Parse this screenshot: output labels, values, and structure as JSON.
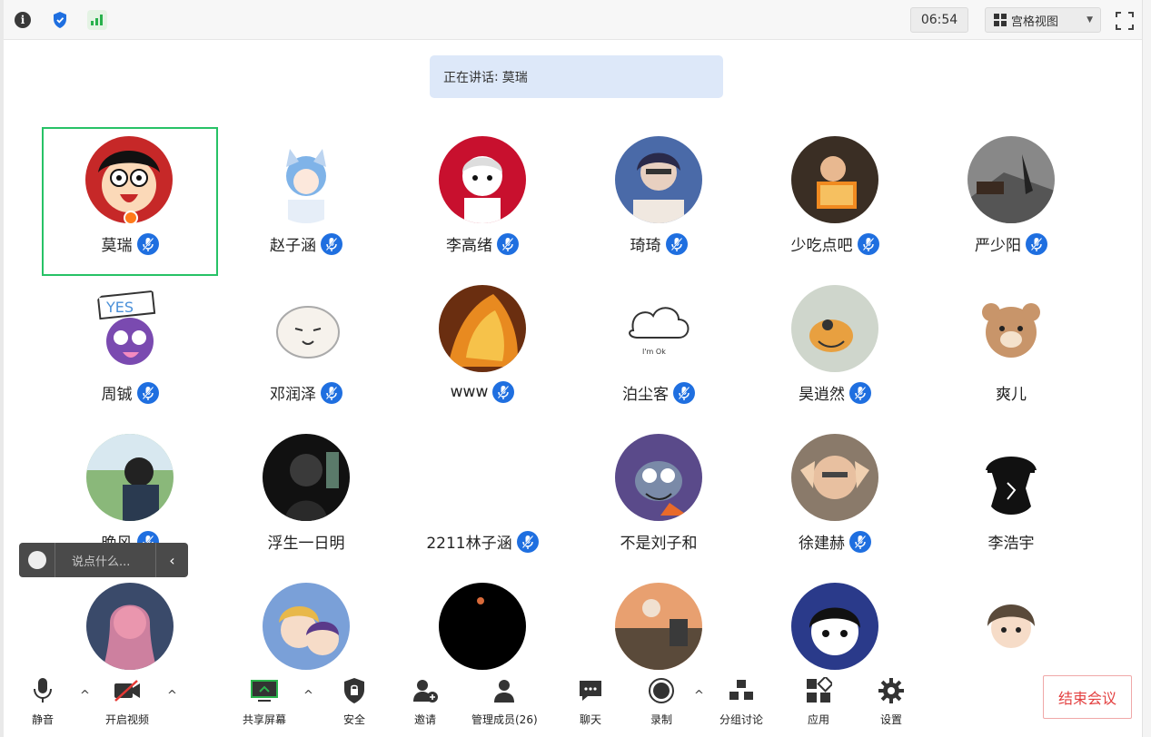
{
  "top_bar": {
    "info_icon": "info-icon",
    "shield_icon": "shield-icon",
    "signal_icon": "signal-bars-icon",
    "timer": "06:54",
    "view_mode": "宫格视图",
    "fullscreen_icon": "fullscreen-icon"
  },
  "speaking": {
    "prefix": "正在讲话",
    "separator": ":",
    "name": "莫瑞"
  },
  "participants": [
    {
      "name": "莫瑞",
      "mic": true,
      "host": true,
      "active": true
    },
    {
      "name": "赵子涵",
      "mic": true
    },
    {
      "name": "李高绪",
      "mic": true
    },
    {
      "name": "琦琦",
      "mic": true
    },
    {
      "name": "少吃点吧",
      "mic": true
    },
    {
      "name": "严少阳",
      "mic": true
    },
    {
      "name": "周铖",
      "mic": true
    },
    {
      "name": "邓润泽",
      "mic": true
    },
    {
      "name": "www",
      "mic": true
    },
    {
      "name": "泊尘客",
      "mic": true
    },
    {
      "name": "昊逍然",
      "mic": true
    },
    {
      "name": "爽儿",
      "mic": false
    },
    {
      "name": "晚风",
      "mic": true
    },
    {
      "name": "浮生一日明",
      "mic": false
    },
    {
      "name": "2211林子涵",
      "mic": true
    },
    {
      "name": "不是刘子和",
      "mic": false
    },
    {
      "name": "徐建赫",
      "mic": true
    },
    {
      "name": "李浩宇",
      "mic": false
    },
    {
      "name": "",
      "mic": false
    },
    {
      "name": "",
      "mic": false
    },
    {
      "name": "",
      "mic": false
    },
    {
      "name": "",
      "mic": false
    },
    {
      "name": "",
      "mic": false
    },
    {
      "name": "",
      "mic": false
    }
  ],
  "chat": {
    "placeholder": "说点什么...",
    "collapse": "‹"
  },
  "toolbar": {
    "mute": "静音",
    "video": "开启视频",
    "share": "共享屏幕",
    "security": "安全",
    "invite": "邀请",
    "members": "管理成员(26)",
    "chat": "聊天",
    "record": "录制",
    "breakout": "分组讨论",
    "apps": "应用",
    "settings": "设置",
    "end": "结束会议"
  },
  "colors": {
    "accent_blue": "#1f6fe0",
    "active_border": "#27c266",
    "end_red": "#e34040",
    "banner_bg": "#dde8f9"
  }
}
